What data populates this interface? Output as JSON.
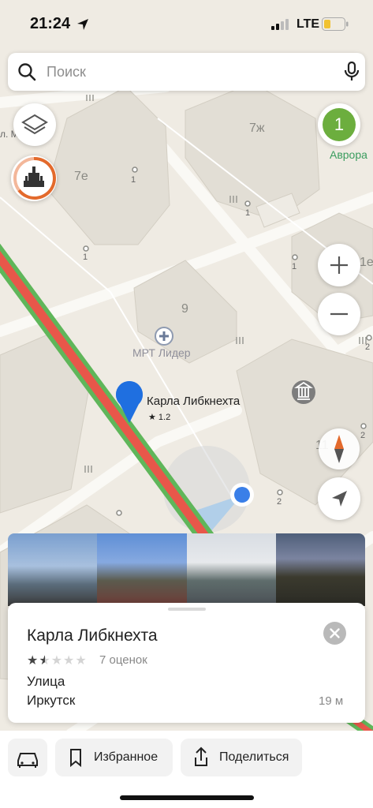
{
  "status_bar": {
    "time": "21:24",
    "network": "LTE"
  },
  "search": {
    "placeholder": "Поиск"
  },
  "map": {
    "buildings": [
      "7ж",
      "7е",
      "9",
      "1е",
      "11"
    ],
    "house_numbers": [
      "1",
      "1",
      "1",
      "1",
      "2",
      "2",
      "2"
    ],
    "cluster_count": "1",
    "poi_avrora": "Аврора",
    "poi_mrt": "МРТ Лидер",
    "poi_street_fragment": "л. М",
    "pin": {
      "title": "Карла Либкнехта",
      "rating": "★ 1.2"
    }
  },
  "card": {
    "title": "Карла Либкнехта",
    "rating_value": 1.5,
    "rating_max": 5,
    "reviews": "7 оценок",
    "type": "Улица",
    "city": "Иркутск",
    "distance": "19 м"
  },
  "bottom_bar": {
    "favorites_label": "Избранное",
    "share_label": "Поделиться"
  },
  "icons": [
    "location-arrow-icon",
    "signal-icon",
    "battery-icon",
    "search-icon",
    "microphone-icon",
    "layers-icon",
    "landmark-icon",
    "plus-icon",
    "minus-icon",
    "compass-icon",
    "navigate-icon",
    "car-icon",
    "bookmark-icon",
    "share-icon",
    "close-icon",
    "museum-icon",
    "hospital-icon"
  ],
  "colors": {
    "traffic_red": "#e8574a",
    "traffic_green": "#5fb65a",
    "cluster_green": "#6cae3e",
    "user_location": "#3a7fe8",
    "pin_blue": "#1f6fe0"
  }
}
